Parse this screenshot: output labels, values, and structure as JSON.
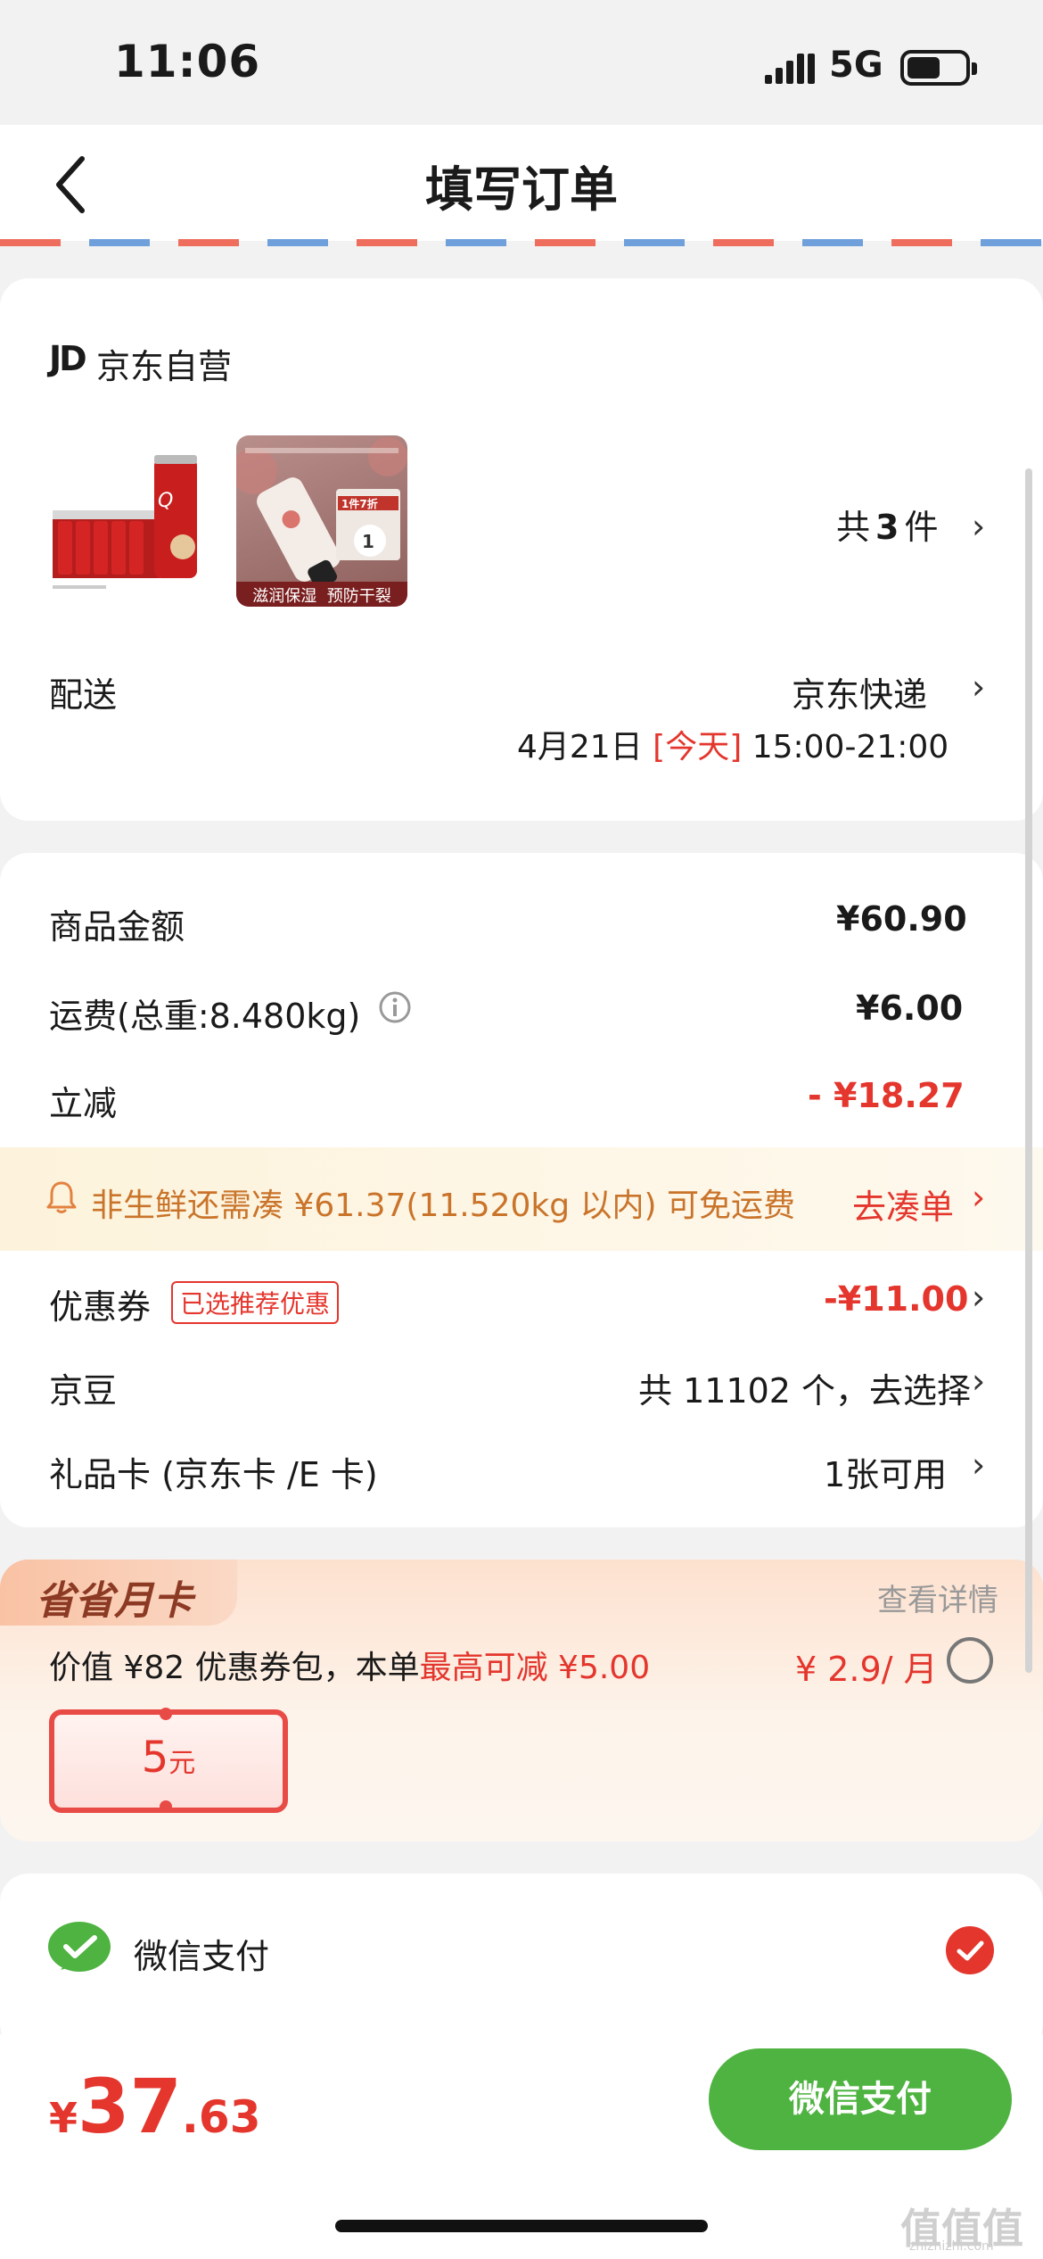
{
  "status_bar": {
    "time": "11:06",
    "network": "5G"
  },
  "header": {
    "title": "填写订单"
  },
  "shop": {
    "logo": "JD",
    "name": "京东自营"
  },
  "products": {
    "item2_badge": "1件7折",
    "item2_caption": "滋润保湿  预防干裂",
    "count_prefix": "共",
    "count": "3",
    "count_suffix": "件"
  },
  "delivery": {
    "label": "配送",
    "method": "京东快递",
    "date": "4月21日",
    "today": "[今天]",
    "window": "15:00-21:00"
  },
  "summary": {
    "goods_label": "商品金额",
    "goods_value": "¥60.90",
    "shipping_label": "运费(总重:8.480kg)",
    "shipping_value": "¥6.00",
    "discount_label": "立减",
    "discount_value": "- ¥18.27",
    "notice_text": "非生鲜还需凑 ¥61.37(11.520kg 以内) 可免运费",
    "notice_action": "去凑单",
    "coupon_label": "优惠券",
    "coupon_tag": "已选推荐优惠",
    "coupon_value": "-¥11.00",
    "beans_label": "京豆",
    "beans_value": "共 11102 个，去选择",
    "giftcard_label": "礼品卡 (京东卡 /E 卡)",
    "giftcard_value": "1张可用"
  },
  "monthly_card": {
    "title": "省省月卡",
    "details_link": "查看详情",
    "desc_prefix": "价值 ¥82 优惠券包，本单",
    "desc_highlight": "最高可减 ¥5.00",
    "price": "¥ 2.9/ 月",
    "coupon_amount": "5",
    "coupon_unit": "元"
  },
  "payment": {
    "method": "微信支付"
  },
  "bottom": {
    "currency": "¥",
    "total_int": "37",
    "total_dec": ".63",
    "pay_button": "微信支付"
  },
  "watermark": {
    "logo": "值值值",
    "url": "zhizhizhi.com"
  },
  "colors": {
    "accent_red": "#e4362d",
    "wechat_green": "#4eb340",
    "notice_bg": "#fdf6e3"
  }
}
